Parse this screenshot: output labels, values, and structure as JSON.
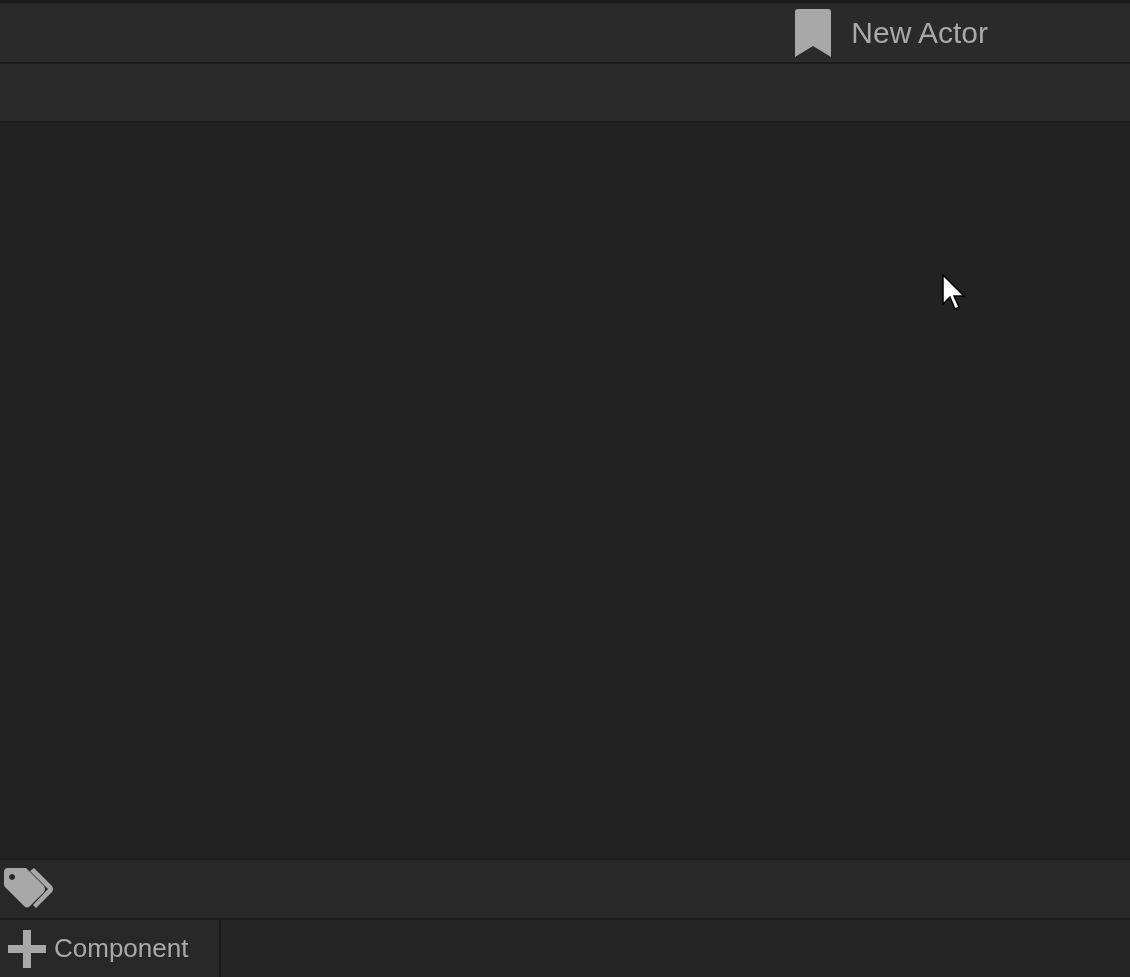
{
  "header": {
    "title": "New Actor"
  },
  "footer": {
    "add_button": {
      "label": "Component"
    }
  }
}
